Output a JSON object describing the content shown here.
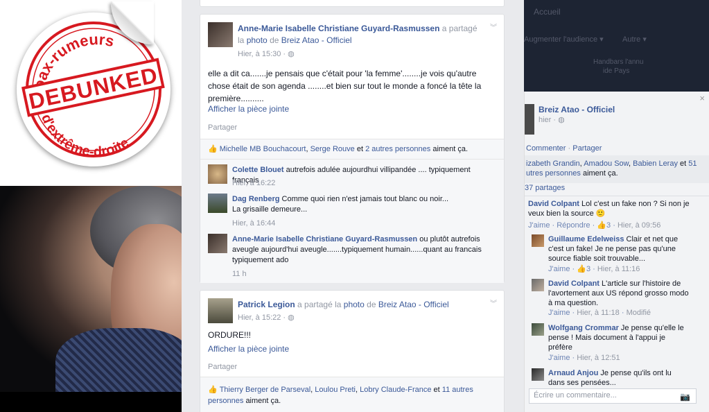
{
  "stamp": {
    "top_text": "Hoax-rumeurs",
    "main_text": "DEBUNKED",
    "bottom_text": "d'extrême-droite",
    "color": "#d71920"
  },
  "posts": [
    {
      "author": "Anne-Marie Isabelle Christiane Guyard-Rasmussen",
      "shared_prefix": "a partagé",
      "shared_middle": "la",
      "shared_object": "photo",
      "shared_de": "de",
      "page": "Breiz Atao - Officiel",
      "time": "Hier, à 15:30 · ",
      "text": "elle a dit ca.......je pensais que c'était pour 'la femme'........je vois qu'autre chose était de son agenda ........et bien sur tout le monde a foncé la tête la première..........",
      "attachment_link": "Afficher la pièce jointe",
      "share_label": "Partager",
      "likes": {
        "names": [
          "Michelle MB Bouchacourt",
          "Serge Rouve"
        ],
        "sep": ",",
        "et": "et",
        "others": "2 autres personnes",
        "suffix": "aiment ça."
      },
      "comments": [
        {
          "author": "Colette Blouet",
          "text": "autrefois adulée aujourdhui villipandée .... typiquement français",
          "time": "Hier, à 16:22"
        },
        {
          "author": "Dag Renberg",
          "text": "Comme quoi rien n'est jamais tout blanc ou noir...",
          "text2": "La grisaille demeure...",
          "time": "Hier, à 16:44"
        },
        {
          "author": "Anne-Marie Isabelle Christiane Guyard-Rasmussen",
          "text": "ou plutôt autrefois",
          "text2": "aveugle aujourd'hui aveugle.......typiquement humain......quant au francais",
          "text3": "typiquement ado",
          "time": "11 h"
        }
      ]
    },
    {
      "author": "Patrick Legion",
      "shared_prefix": "a partagé la",
      "shared_object": "photo",
      "shared_de": "de",
      "page": "Breiz Atao - Officiel",
      "time": "Hier, à 15:22 · ",
      "text": "ORDURE!!!",
      "attachment_link": "Afficher la pièce jointe",
      "share_label": "Partager",
      "likes": {
        "names": [
          "Thierry Berger de Parseval",
          "Loulou Preti",
          "Lobry Claude-France"
        ],
        "sep": ",",
        "et": "et",
        "others": "11 autres personnes",
        "suffix": "aiment ça."
      }
    }
  ],
  "topbar": {
    "accueil": "Accueil",
    "audience": "Augmenter l'audience ▾",
    "autre": "Autre ▾",
    "hint1": "Handbars l'annu",
    "hint2": "ide Pays"
  },
  "chat": {
    "close": "×",
    "page": "Breiz Atao - Officiel",
    "time": "hier · ",
    "actions": {
      "comment": "Commenter",
      "sep": " · ",
      "share": "Partager"
    },
    "likes_line1_names": [
      "izabeth Grandin",
      "Amadou Sow",
      "Babien Leray"
    ],
    "likes_line1_et": "et",
    "likes_line1_others": "51",
    "likes_line2": "utres personnes",
    "likes_line2_suffix": "aiment ça.",
    "shares": "37 partages",
    "comments": [
      {
        "author": "David Colpant",
        "text1": "Lol c'est un fake non ? Si non je",
        "text2": "veux bien la source 🙂",
        "jaime": "J'aime",
        "reply": "Répondre",
        "likes": "3",
        "time": "Hier, à 09:56"
      },
      {
        "author": "Guillaume Edelweiss",
        "text0": "Clair et net que",
        "text1": "c'est un fake! Je ne pense pas qu'une",
        "text2": "source fiable soit trouvable...",
        "jaime": "J'aime",
        "likes": "3",
        "time": "Hier, à 11:16"
      },
      {
        "author": "David Colpant",
        "text0": "L'article sur l'histoire de",
        "text1": "l'avortement aux US répond grosso modo",
        "text2": "à ma question.",
        "jaime": "J'aime",
        "time": "Hier, à 11:18",
        "extra": "Modifié"
      },
      {
        "author": "Wolfgang Crommar",
        "text0": "Je pense qu'elle le",
        "text1": "pense ! Mais document à l'appui je",
        "text2": "préfère",
        "jaime": "J'aime",
        "time": "Hier, à 12:51"
      },
      {
        "author": "Arnaud Anjou",
        "text0": "Je pense qu'ils ont lu",
        "text1": "dans ses pensées..."
      }
    ],
    "input_placeholder": "Écrire un commentaire..."
  }
}
